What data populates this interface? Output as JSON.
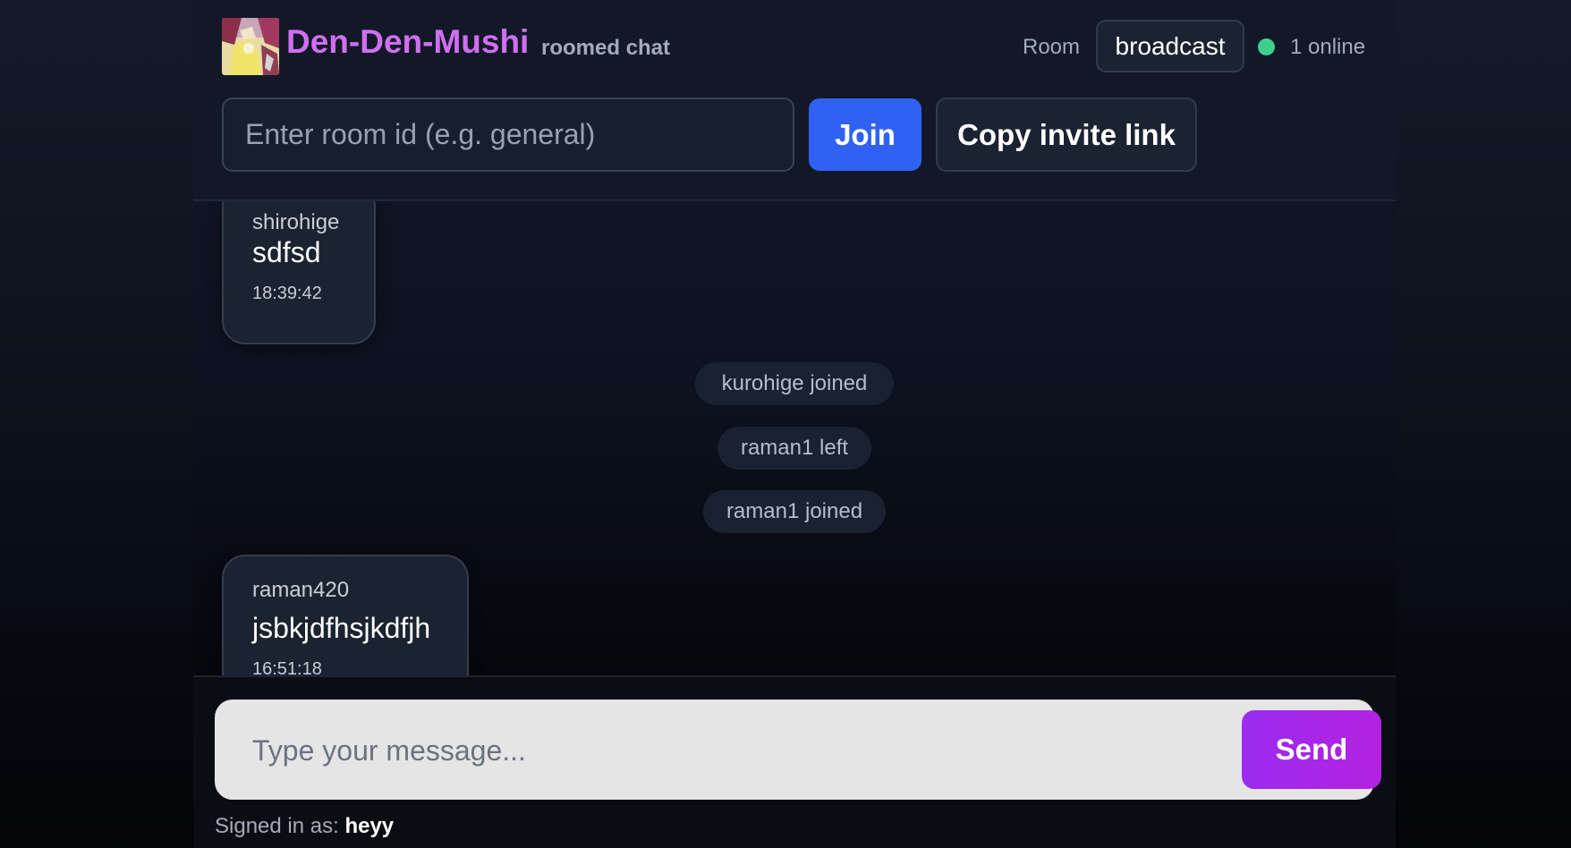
{
  "header": {
    "app_name": "Den-Den-Mushi",
    "subtitle": "roomed chat",
    "room_label": "Room",
    "current_room": "broadcast",
    "online_text": "1 online",
    "online_color": "#3ecf8e",
    "brand_color": "#cf6ff0"
  },
  "room_controls": {
    "input_placeholder": "Enter room id (e.g. general)",
    "input_value": "",
    "join_label": "Join",
    "copy_label": "Copy invite link"
  },
  "messages": [
    {
      "sender": "shirohige",
      "text": "sdfsd",
      "time": "18:39:42"
    },
    {
      "system": "kurohige joined"
    },
    {
      "system": "raman1 left"
    },
    {
      "system": "raman1 joined"
    },
    {
      "sender": "raman420",
      "text": "jsbkjdfhsjkdfjh",
      "time": "16:51:18"
    }
  ],
  "composer": {
    "placeholder": "Type your message...",
    "value": "",
    "send_label": "Send"
  },
  "footer": {
    "signed_in_label": "Signed in as:",
    "username": "heyy"
  }
}
